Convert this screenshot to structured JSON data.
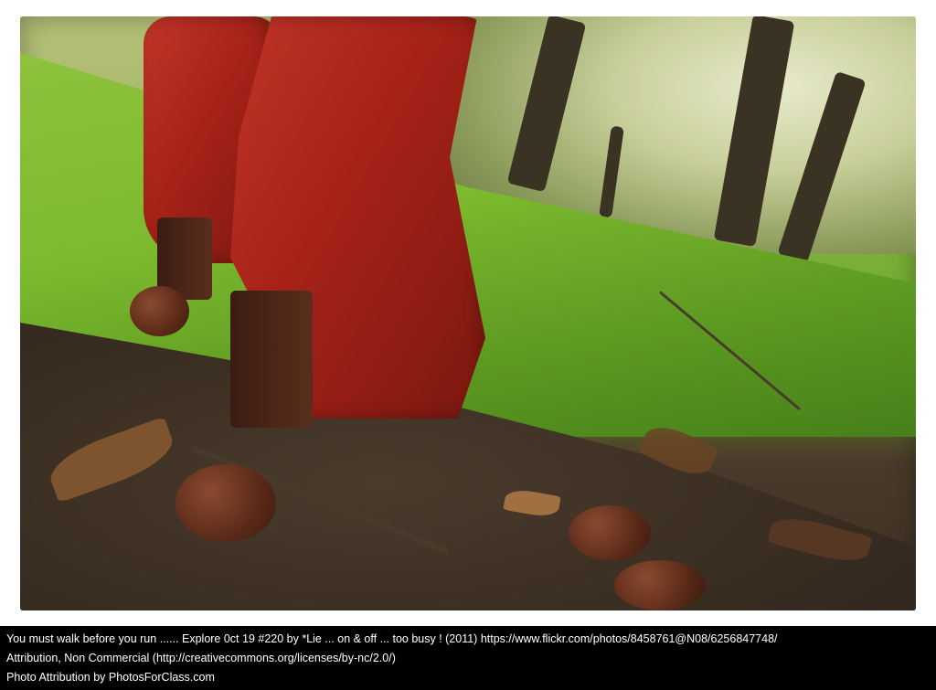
{
  "caption": {
    "line1": "You must walk before you run ...... Explore 0ct 19 #220 by *Lie ... on & off ... too busy ! (2011) https://www.flickr.com/photos/8458761@N08/6256847748/",
    "line2": "Attribution, Non Commercial (http://creativecommons.org/licenses/by-nc/2.0/)",
    "line3": "Photo Attribution by PhotosForClass.com"
  },
  "colors": {
    "caption_background": "#000000",
    "caption_text": "#ffffff",
    "boot_red": "#a52218",
    "grass_green": "#7cba2e"
  }
}
